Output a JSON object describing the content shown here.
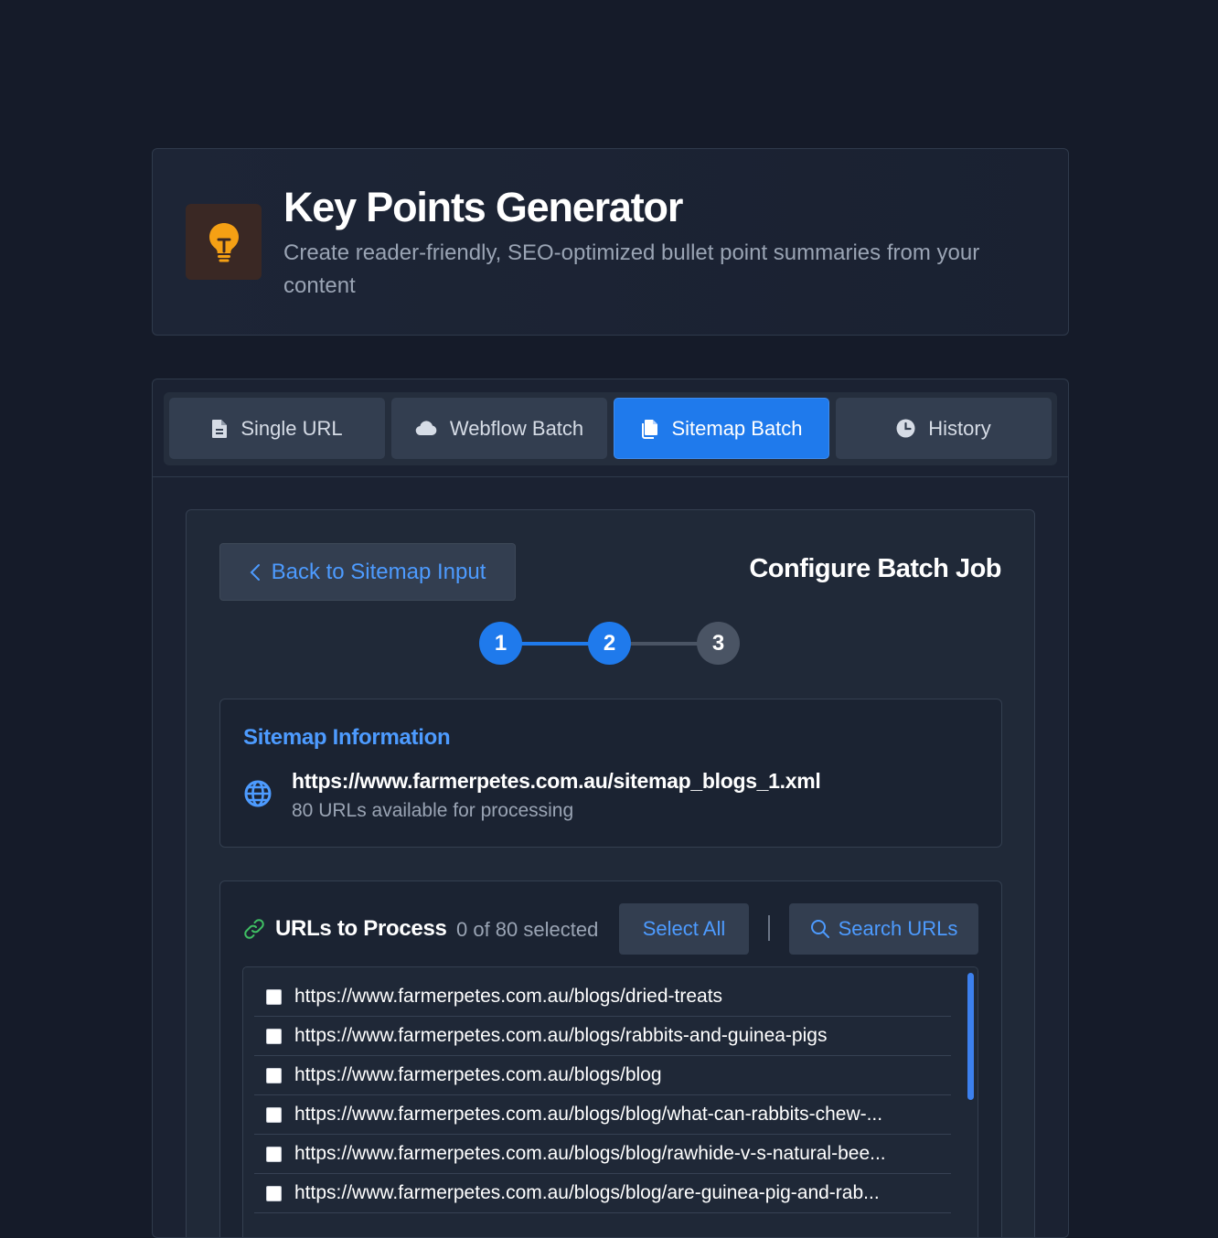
{
  "header": {
    "title": "Key Points Generator",
    "subtitle": "Create reader-friendly, SEO-optimized bullet point summaries from your content",
    "logo_icon": "lightbulb-icon"
  },
  "tabs": [
    {
      "label": "Single URL",
      "icon": "document-icon",
      "active": false
    },
    {
      "label": "Webflow Batch",
      "icon": "cloud-icon",
      "active": false
    },
    {
      "label": "Sitemap Batch",
      "icon": "files-icon",
      "active": true
    },
    {
      "label": "History",
      "icon": "clock-icon",
      "active": false
    }
  ],
  "config": {
    "back_label": "Back to Sitemap Input",
    "title": "Configure Batch Job",
    "steps": [
      "1",
      "2",
      "3"
    ],
    "current_step": 2
  },
  "sitemap_info": {
    "heading": "Sitemap Information",
    "url": "https://www.farmerpetes.com.au/sitemap_blogs_1.xml",
    "count_text": "80 URLs available for processing"
  },
  "urls": {
    "title": "URLs to Process",
    "selected_text": "0 of 80 selected",
    "select_all_label": "Select All",
    "search_label": "Search URLs",
    "items": [
      "https://www.farmerpetes.com.au/blogs/dried-treats",
      "https://www.farmerpetes.com.au/blogs/rabbits-and-guinea-pigs",
      "https://www.farmerpetes.com.au/blogs/blog",
      "https://www.farmerpetes.com.au/blogs/blog/what-can-rabbits-chew-...",
      "https://www.farmerpetes.com.au/blogs/blog/rawhide-v-s-natural-bee...",
      "https://www.farmerpetes.com.au/blogs/blog/are-guinea-pig-and-rab..."
    ]
  },
  "colors": {
    "accent": "#1f7aec",
    "link": "#4d9bff",
    "background": "#151b29"
  }
}
